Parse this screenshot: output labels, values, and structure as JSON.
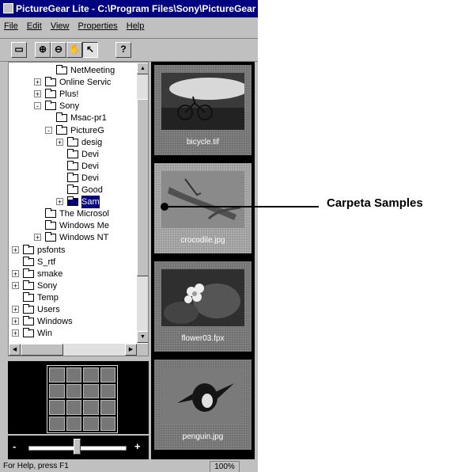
{
  "window": {
    "title": "PictureGear Lite - C:\\Program Files\\Sony\\PictureGear"
  },
  "menu": {
    "items": [
      "File",
      "Edit",
      "View",
      "Properties",
      "Help"
    ]
  },
  "toolbar": {
    "buttons": [
      {
        "name": "print-icon",
        "glyph": "▭"
      },
      {
        "name": "zoom-in-icon",
        "glyph": "⊕"
      },
      {
        "name": "zoom-out-icon",
        "glyph": "⊖"
      },
      {
        "name": "hand-icon",
        "glyph": "✋"
      },
      {
        "name": "pointer-icon",
        "glyph": "↖"
      },
      {
        "name": "help-icon",
        "glyph": "?"
      }
    ],
    "pressed_index": 4
  },
  "tree": {
    "items": [
      {
        "label": "NetMeeting",
        "level": 3,
        "expander": "",
        "selected": false
      },
      {
        "label": "Online Servic",
        "level": 2,
        "expander": "+",
        "selected": false
      },
      {
        "label": "Plus!",
        "level": 2,
        "expander": "+",
        "selected": false
      },
      {
        "label": "Sony",
        "level": 2,
        "expander": "-",
        "selected": false
      },
      {
        "label": "Msac-pr1",
        "level": 3,
        "expander": "",
        "selected": false
      },
      {
        "label": "PictureG",
        "level": 3,
        "expander": "-",
        "selected": false
      },
      {
        "label": "desig",
        "level": 4,
        "expander": "+",
        "selected": false
      },
      {
        "label": "Devi",
        "level": 4,
        "expander": "",
        "selected": false
      },
      {
        "label": "Devi",
        "level": 4,
        "expander": "",
        "selected": false
      },
      {
        "label": "Devi",
        "level": 4,
        "expander": "",
        "selected": false
      },
      {
        "label": "Good",
        "level": 4,
        "expander": "",
        "selected": false
      },
      {
        "label": "Sam",
        "level": 4,
        "expander": "+",
        "selected": true
      },
      {
        "label": "The Microsol",
        "level": 2,
        "expander": "",
        "selected": false
      },
      {
        "label": "Windows Me",
        "level": 2,
        "expander": "",
        "selected": false
      },
      {
        "label": "Windows NT",
        "level": 2,
        "expander": "+",
        "selected": false
      },
      {
        "label": "psfonts",
        "level": 0,
        "expander": "+",
        "selected": false
      },
      {
        "label": "S_rtf",
        "level": 0,
        "expander": "",
        "selected": false
      },
      {
        "label": "smake",
        "level": 0,
        "expander": "+",
        "selected": false
      },
      {
        "label": "Sony",
        "level": 0,
        "expander": "+",
        "selected": false
      },
      {
        "label": "Temp",
        "level": 0,
        "expander": "",
        "selected": false
      },
      {
        "label": "Users",
        "level": 0,
        "expander": "+",
        "selected": false
      },
      {
        "label": "Windows",
        "level": 0,
        "expander": "+",
        "selected": false
      },
      {
        "label": "Win",
        "level": 0,
        "expander": "+",
        "selected": false
      }
    ]
  },
  "preview": {
    "minus": "-",
    "plus": "+"
  },
  "zoom_slider": {
    "value_fraction": 0.5
  },
  "thumbnails": [
    {
      "caption": "bicycle.tif",
      "selected": false
    },
    {
      "caption": "crocodile.jpg",
      "selected": true
    },
    {
      "caption": "flower03.fpx",
      "selected": false
    },
    {
      "caption": "penguin.jpg",
      "selected": false
    }
  ],
  "status": {
    "text": "For Help, press F1",
    "zoom": "100%"
  },
  "annotation": {
    "label": "Carpeta Samples"
  },
  "colors": {
    "titlebar": "#000080",
    "face": "#c0c0c0",
    "panel": "#000000",
    "selection": "#000080"
  }
}
